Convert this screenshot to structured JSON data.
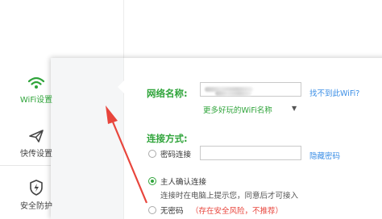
{
  "sidebar": {
    "items": [
      {
        "label": "WiFi设置",
        "icon": "wifi-icon",
        "active": true
      },
      {
        "label": "快传设置",
        "icon": "paper-plane-icon",
        "active": false
      },
      {
        "label": "安全防护",
        "icon": "shield-bolt-icon",
        "active": false
      }
    ]
  },
  "wifi": {
    "name_label": "网络名称:",
    "ssid_value": "",
    "find_link": "找不到此WiFi?",
    "more_names_link": "更多好玩的WiFi名称"
  },
  "connection": {
    "label": "连接方式:",
    "password_option": "密码连接",
    "password_value": "",
    "hide_password_link": "隐藏密码",
    "host_confirm_option": "主人确认连接",
    "host_confirm_hint": "连接时在电脑上提示您，同意后才可接入",
    "no_password_option": "无密码",
    "no_password_warning": "（存在安全风险，不推荐）"
  },
  "colors": {
    "accent": "#2fa43a",
    "link": "#3a8ee6",
    "arrow": "#e8453c"
  }
}
